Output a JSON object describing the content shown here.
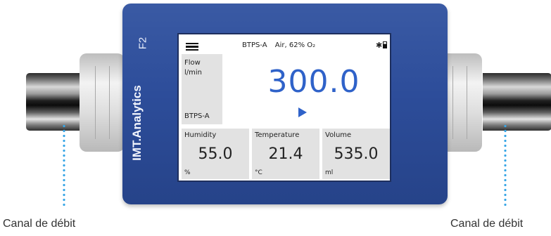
{
  "device": {
    "model": "F2",
    "brand": "IMT.Analytics"
  },
  "screen": {
    "status": {
      "mode": "BTPS-A",
      "gas": "Air, 62% O₂",
      "bluetooth_icon": "bluetooth-icon",
      "battery_icon": "battery-icon"
    },
    "flow": {
      "label": "Flow",
      "unit": "l/min",
      "mode": "BTPS-A",
      "value": "300.0"
    },
    "readouts": [
      {
        "label": "Humidity",
        "value": "55.0",
        "unit": "%"
      },
      {
        "label": "Temperature",
        "value": "21.4",
        "unit": "°C"
      },
      {
        "label": "Volume",
        "value": "535.0",
        "unit": "ml"
      }
    ]
  },
  "annotations": {
    "left_channel": "Canal de débit",
    "right_channel": "Canal de débit"
  },
  "colors": {
    "device_body": "#2d4d9a",
    "value_accent": "#2f62c9",
    "annotation_dots": "#39a6e6"
  }
}
